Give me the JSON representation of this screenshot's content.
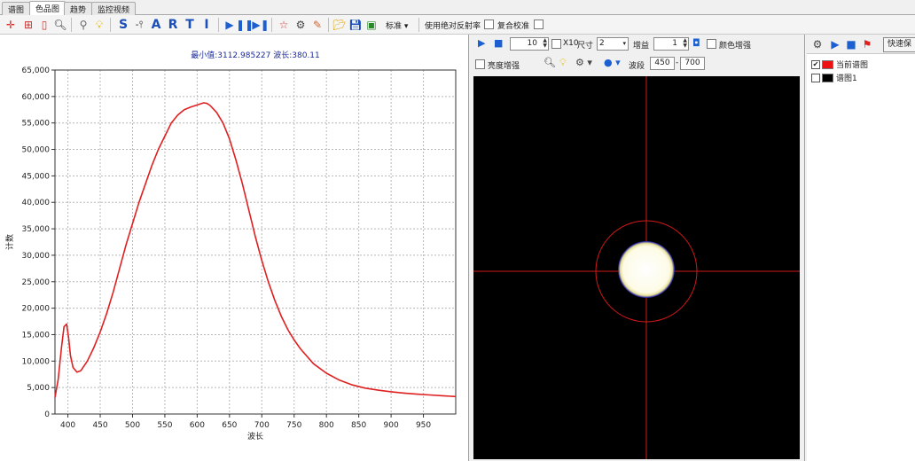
{
  "tabs": [
    {
      "label": "谱图",
      "active": false
    },
    {
      "label": "色品图",
      "active": true
    },
    {
      "label": "趋势",
      "active": false
    },
    {
      "label": "监控视频",
      "active": false
    }
  ],
  "toolbar": {
    "letters": [
      "S",
      "A",
      "R",
      "T",
      "I"
    ],
    "mode_combo": "标准",
    "abs_reflect_label": "使用绝对反射率",
    "recheck_label": "复合校准"
  },
  "chart_data": {
    "type": "line",
    "title": "最小值:3112.985227  波长:380.11",
    "xlabel": "波长",
    "ylabel": "计数",
    "xlim": [
      380,
      1000
    ],
    "ylim": [
      0,
      65000
    ],
    "x_ticks": [
      400,
      450,
      500,
      550,
      600,
      650,
      700,
      750,
      800,
      850,
      900,
      950
    ],
    "y_ticks": [
      0,
      5000,
      10000,
      15000,
      20000,
      25000,
      30000,
      35000,
      40000,
      45000,
      50000,
      55000,
      60000,
      65000
    ],
    "x_tick_labels": [
      "400",
      "450",
      "500",
      "550",
      "600",
      "650",
      "700",
      "750",
      "800",
      "850",
      "900",
      "950"
    ],
    "y_tick_labels": [
      "0",
      "5,000",
      "10,000",
      "15,000",
      "20,000",
      "25,000",
      "30,000",
      "35,000",
      "40,000",
      "45,000",
      "50,000",
      "55,000",
      "60,000",
      "65,000"
    ],
    "grid": true,
    "series": [
      {
        "color": "#e02020",
        "x": [
          380,
          385,
          390,
          394,
          398,
          401,
          404,
          408,
          414,
          420,
          430,
          440,
          450,
          460,
          470,
          480,
          490,
          500,
          510,
          520,
          530,
          540,
          550,
          560,
          570,
          580,
          590,
          600,
          610,
          615,
          620,
          630,
          640,
          650,
          660,
          670,
          680,
          690,
          700,
          710,
          720,
          730,
          740,
          750,
          760,
          780,
          800,
          820,
          840,
          860,
          880,
          900,
          920,
          940,
          960,
          980,
          1000
        ],
        "y": [
          3112,
          6500,
          12500,
          16500,
          17000,
          14500,
          11000,
          8800,
          7900,
          8200,
          10000,
          12500,
          15500,
          19000,
          23000,
          27500,
          32000,
          36000,
          40000,
          43500,
          47000,
          50000,
          52500,
          55000,
          56500,
          57500,
          58000,
          58400,
          58800,
          58700,
          58300,
          57000,
          55000,
          52000,
          48000,
          43500,
          38500,
          33500,
          29000,
          25000,
          21500,
          18500,
          16000,
          14000,
          12300,
          9500,
          7700,
          6400,
          5500,
          4900,
          4500,
          4200,
          3950,
          3750,
          3600,
          3450,
          3300
        ]
      }
    ]
  },
  "mid": {
    "frames_value": "10",
    "x10_label": "X10",
    "size_label": "尺寸",
    "size_value": "2",
    "gain_label": "增益",
    "gain_value": "1",
    "color_enhance_label": "颜色增强",
    "bright_enhance_label": "亮度增强",
    "band_label": "波段",
    "band_from": "450",
    "band_sep": "-",
    "band_to": "700"
  },
  "right": {
    "quick_button": "快速保",
    "legend": [
      {
        "label": "当前谱图",
        "checked": true,
        "color": "#ee1111"
      },
      {
        "label": "谱图1",
        "checked": false,
        "color": "#000000"
      }
    ]
  }
}
